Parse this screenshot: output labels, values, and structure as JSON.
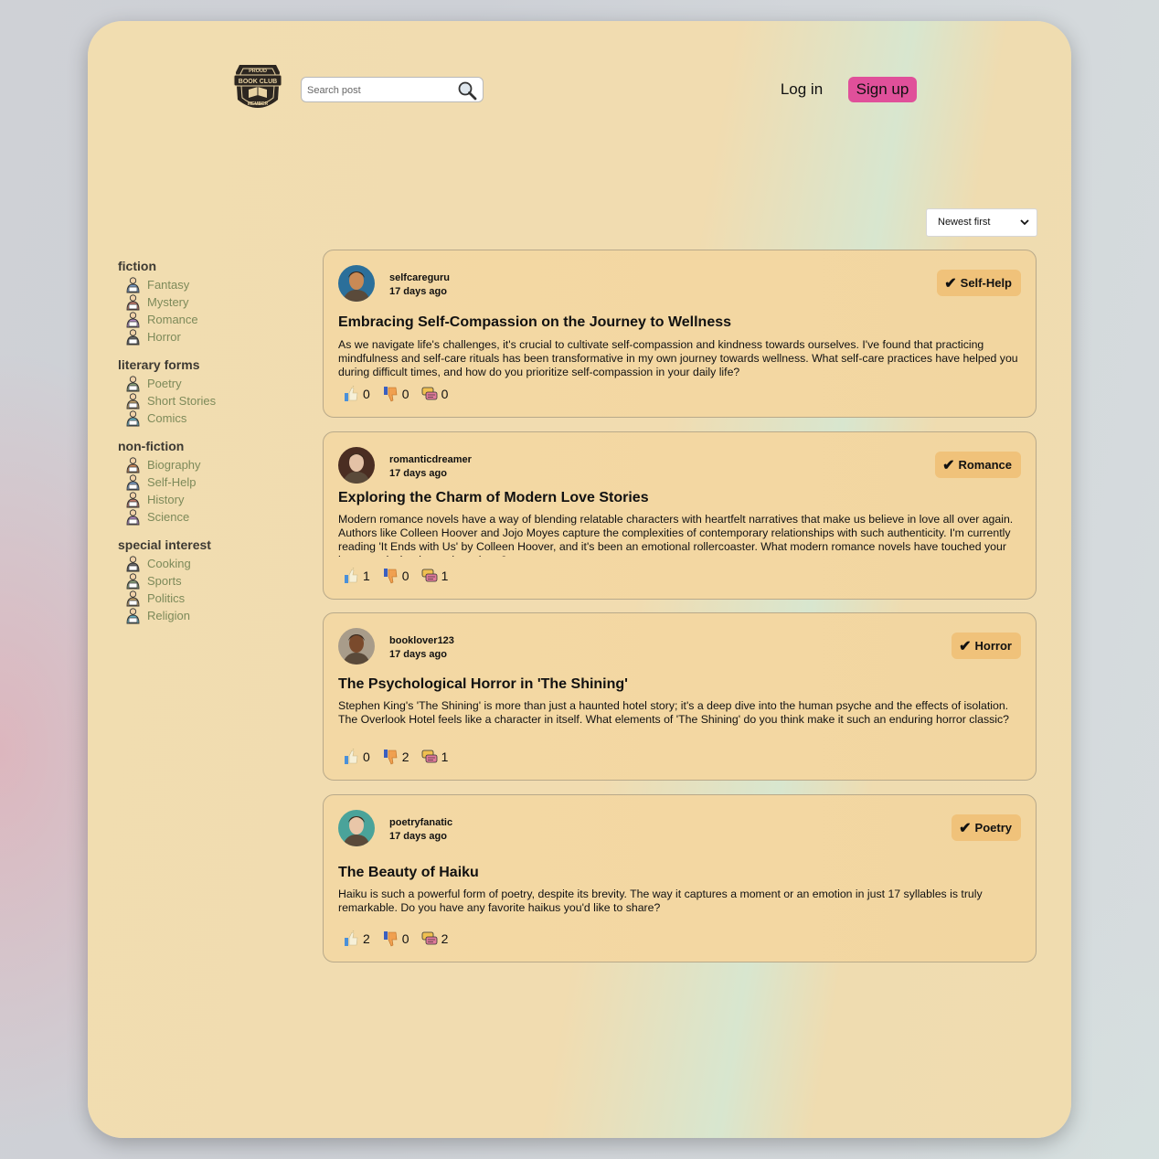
{
  "header": {
    "logo_text": [
      "PROUD",
      "BOOK CLUB",
      "MEMBER"
    ],
    "search_placeholder": "Search post",
    "login_label": "Log in",
    "signup_label": "Sign up"
  },
  "sort": {
    "selected": "Newest first"
  },
  "sidebar": {
    "groups": [
      {
        "title": "fiction",
        "items": [
          {
            "label": "Fantasy",
            "icon": "wizard-icon"
          },
          {
            "label": "Mystery",
            "icon": "detective-icon"
          },
          {
            "label": "Romance",
            "icon": "couple-icon"
          },
          {
            "label": "Horror",
            "icon": "ghost-icon"
          }
        ]
      },
      {
        "title": "literary forms",
        "items": [
          {
            "label": "Poetry",
            "icon": "poem-icon"
          },
          {
            "label": "Short Stories",
            "icon": "book-stack-icon"
          },
          {
            "label": "Comics",
            "icon": "comic-icon"
          }
        ]
      },
      {
        "title": "non-fiction",
        "items": [
          {
            "label": "Biography",
            "icon": "person-book-icon"
          },
          {
            "label": "Self-Help",
            "icon": "meditation-icon"
          },
          {
            "label": "History",
            "icon": "scroll-icon"
          },
          {
            "label": "Science",
            "icon": "flask-icon"
          }
        ]
      },
      {
        "title": "special interest",
        "items": [
          {
            "label": "Cooking",
            "icon": "chef-icon"
          },
          {
            "label": "Sports",
            "icon": "ball-icon"
          },
          {
            "label": "Politics",
            "icon": "people-icon"
          },
          {
            "label": "Religion",
            "icon": "temple-icon"
          }
        ]
      }
    ]
  },
  "posts": [
    {
      "username": "selfcareguru",
      "time": "17 days ago",
      "tag": "Self-Help",
      "title": "Embracing Self-Compassion on the Journey to Wellness",
      "body": "As we navigate life's challenges, it's crucial to cultivate self-compassion and kindness towards ourselves. I've found that practicing mindfulness and self-care rituals has been transformative in my own journey towards wellness. What self-care practices have helped you during difficult times, and how do you prioritize self-compassion in your daily life?",
      "likes": "0",
      "dislikes": "0",
      "comments": "0",
      "avatar_colors": [
        "#c98a55",
        "#2b6f9a"
      ]
    },
    {
      "username": "romanticdreamer",
      "time": "17 days ago",
      "tag": "Romance",
      "title": "Exploring the Charm of Modern Love Stories",
      "body": "Modern romance novels have a way of blending relatable characters with heartfelt narratives that make us believe in love all over again. Authors like Colleen Hoover and Jojo Moyes capture the complexities of contemporary relationships with such authenticity. I'm currently reading 'It Ends with Us' by Colleen Hoover, and it's been an emotional rollercoaster. What modern romance novels have touched your heart, and why do you love them?",
      "likes": "1",
      "dislikes": "0",
      "comments": "1",
      "avatar_colors": [
        "#e4c2a6",
        "#4a2d22"
      ]
    },
    {
      "username": "booklover123",
      "time": "17 days ago",
      "tag": "Horror",
      "title": "The Psychological Horror in 'The Shining'",
      "body": "Stephen King's 'The Shining' is more than just a haunted hotel story; it's a deep dive into the human psyche and the effects of isolation. The Overlook Hotel feels like a character in itself. What elements of 'The Shining' do you think make it such an enduring horror classic?",
      "likes": "0",
      "dislikes": "2",
      "comments": "1",
      "avatar_colors": [
        "#7a4a2c",
        "#a89c8a"
      ]
    },
    {
      "username": "poetryfanatic",
      "time": "17 days ago",
      "tag": "Poetry",
      "title": "The Beauty of Haiku",
      "body": "Haiku is such a powerful form of poetry, despite its brevity. The way it captures a moment or an emotion in just 17 syllables is truly remarkable. Do you have any favorite haikus you'd like to share?",
      "likes": "2",
      "dislikes": "0",
      "comments": "2",
      "avatar_colors": [
        "#e9c6a8",
        "#4aa39a"
      ]
    }
  ]
}
